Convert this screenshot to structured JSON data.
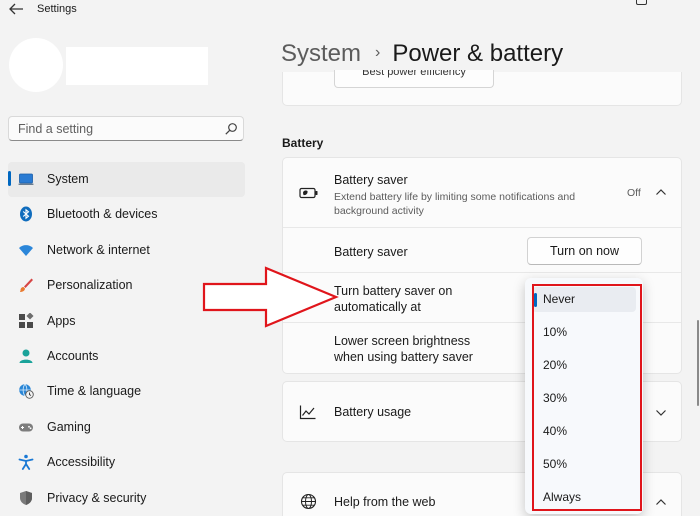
{
  "window": {
    "title": "Settings"
  },
  "search": {
    "placeholder": "Find a setting"
  },
  "sidebar": {
    "items": [
      {
        "label": "System",
        "icon": "laptop-icon",
        "selected": true
      },
      {
        "label": "Bluetooth & devices",
        "icon": "bluetooth-icon"
      },
      {
        "label": "Network & internet",
        "icon": "wifi-icon"
      },
      {
        "label": "Personalization",
        "icon": "brush-icon"
      },
      {
        "label": "Apps",
        "icon": "apps-icon"
      },
      {
        "label": "Accounts",
        "icon": "person-icon"
      },
      {
        "label": "Time & language",
        "icon": "globe-clock-icon"
      },
      {
        "label": "Gaming",
        "icon": "gamepad-icon"
      },
      {
        "label": "Accessibility",
        "icon": "accessibility-icon"
      },
      {
        "label": "Privacy & security",
        "icon": "shield-icon"
      }
    ]
  },
  "header": {
    "parent": "System",
    "separator": "›",
    "current": "Power & battery"
  },
  "top_card": {
    "button_label": "Best power efficiency"
  },
  "battery_section": {
    "title": "Battery",
    "saver": {
      "title": "Battery saver",
      "description": "Extend battery life by limiting some notifications and background activity",
      "status": "Off"
    },
    "rows": {
      "saver_label": "Battery saver",
      "turn_on_label": "Turn on now",
      "auto_line1": "Turn battery saver on",
      "auto_line2": "automatically at",
      "bright_line1": "Lower screen brightness",
      "bright_line2": "when using battery saver"
    },
    "usage_label": "Battery usage",
    "help_label": "Help from the web"
  },
  "dropdown": {
    "selected": "Never",
    "options": [
      "Never",
      "10%",
      "20%",
      "30%",
      "40%",
      "50%",
      "Always"
    ]
  },
  "colors": {
    "accent": "#0067c0",
    "annotation": "#e0151b"
  }
}
